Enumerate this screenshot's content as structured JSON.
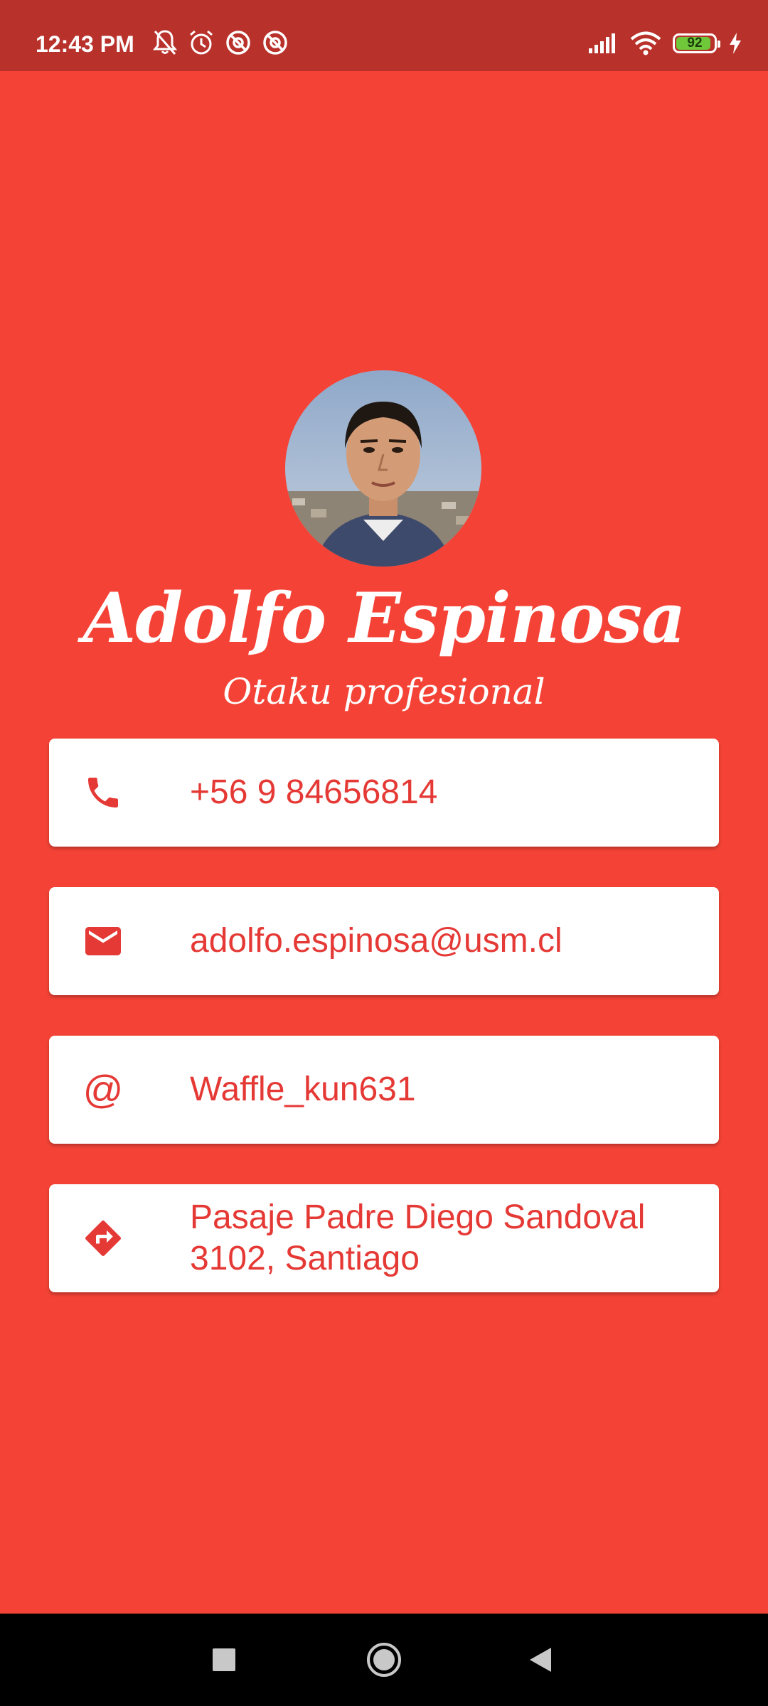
{
  "status_bar": {
    "time": "12:43 PM",
    "battery_level": "92",
    "icons_left": [
      "bell-off-icon",
      "alarm-icon",
      "vpn-icon",
      "vpn-icon"
    ],
    "icons_right": [
      "signal-icon",
      "wifi-icon",
      "battery-icon",
      "charging-icon"
    ]
  },
  "profile": {
    "name": "Adolfo Espinosa",
    "subtitle": "Otaku profesional"
  },
  "cards": [
    {
      "icon": "phone-icon",
      "text": "+56 9 84656814"
    },
    {
      "icon": "mail-icon",
      "text": "adolfo.espinosa@usm.cl"
    },
    {
      "icon": "at-icon",
      "glyph": "@",
      "text": "Waffle_kun631"
    },
    {
      "icon": "directions-icon",
      "text": "Pasaje Padre Diego Sandoval 3102, Santiago"
    }
  ],
  "nav_bar": {
    "buttons": [
      "recents-button",
      "home-button",
      "back-button"
    ]
  },
  "colors": {
    "background": "#F44336",
    "status_bar": "#B9312B",
    "accent": "#E53935",
    "card": "#FFFFFF"
  }
}
